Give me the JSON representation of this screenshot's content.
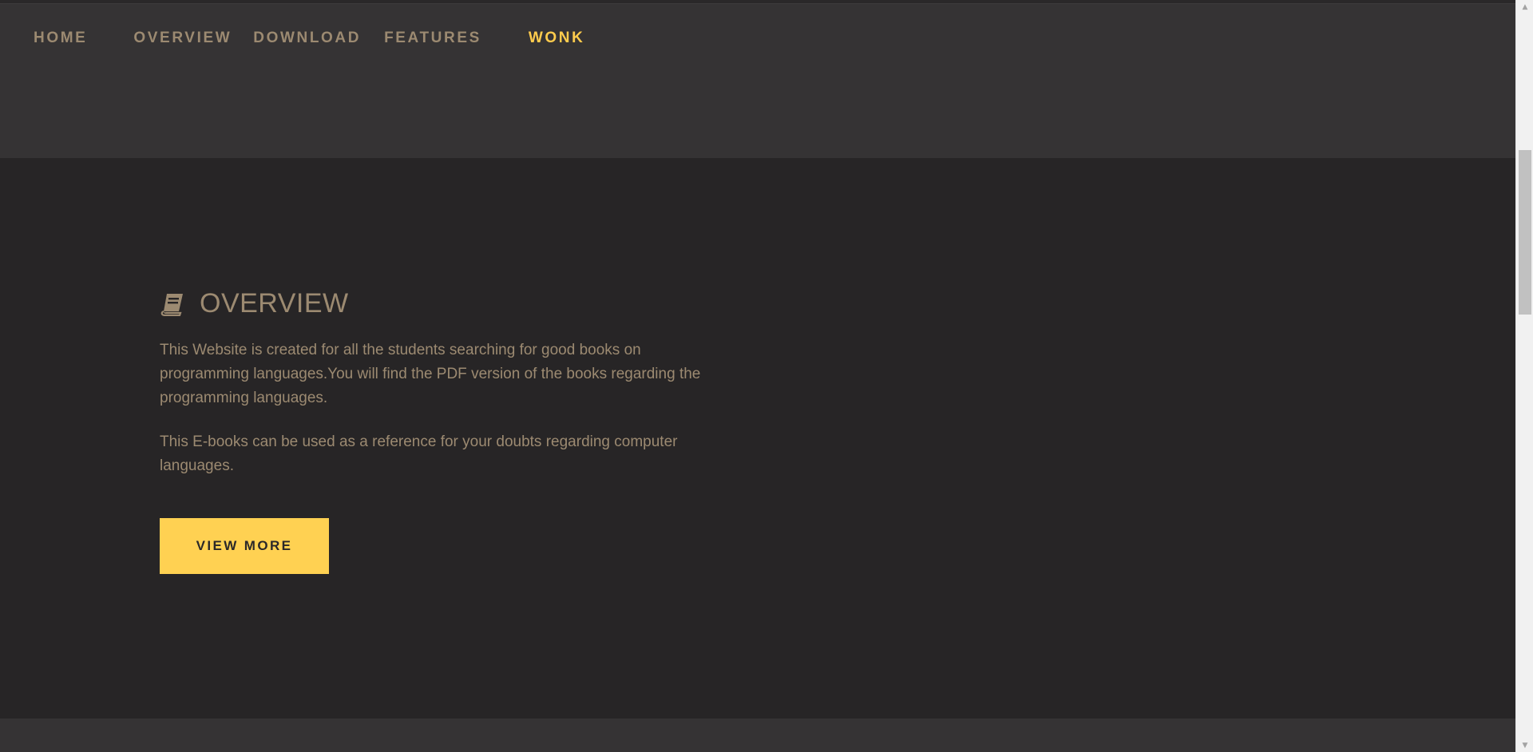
{
  "nav": {
    "items": [
      {
        "label": "HOME"
      },
      {
        "label": "OVERVIEW"
      },
      {
        "label": "DOWNLOAD"
      },
      {
        "label": "FEATURES"
      },
      {
        "label": "WONK"
      }
    ],
    "active": "WONK"
  },
  "overview": {
    "icon": "book-icon",
    "title": "OVERVIEW",
    "paragraphs": [
      "This Website is created for all the students searching for good books on programming languages.You will find the PDF version of the books regarding the programming languages.",
      "This E-books can be used as a reference for your doubts regarding computer languages."
    ],
    "button_label": "VIEW MORE"
  },
  "colors": {
    "background": "#272526",
    "header_background": "#353334",
    "text_muted": "#9c8a71",
    "accent": "#ffcc4d",
    "button_background": "#ffd152"
  }
}
